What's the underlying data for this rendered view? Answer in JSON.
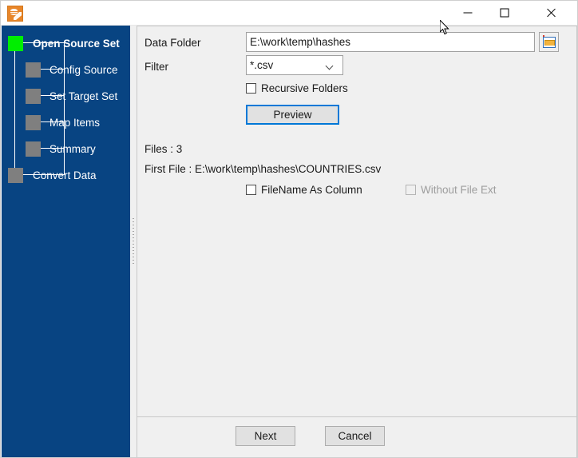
{
  "window": {
    "app_icon": "database-edit-icon",
    "minimize_label": "minimize-icon",
    "maximize_label": "maximize-icon",
    "close_label": "close-icon"
  },
  "sidebar": {
    "steps": [
      {
        "label": "Open Source Set",
        "state": "active"
      },
      {
        "label": "Config Source",
        "state": "pending"
      },
      {
        "label": "Set Target Set",
        "state": "pending"
      },
      {
        "label": "Map Items",
        "state": "pending"
      },
      {
        "label": "Summary",
        "state": "pending"
      },
      {
        "label": "Convert Data",
        "state": "pending"
      }
    ],
    "active_color": "#00ee00",
    "pending_color": "#7f7f7f",
    "background_color": "#084482"
  },
  "form": {
    "data_folder_label": "Data Folder",
    "data_folder_value": "E:\\work\\temp\\hashes",
    "browse_icon": "folder-icon",
    "filter_label": "Filter",
    "filter_value": "*.csv",
    "filter_options": [
      "*.csv"
    ],
    "recursive_label": "Recursive Folders",
    "recursive_checked": false,
    "preview_label": "Preview"
  },
  "results": {
    "files_text": "Files : 3",
    "first_file_text": "First File : E:\\work\\temp\\hashes\\COUNTRIES.csv",
    "filename_as_column_label": "FileName As Column",
    "filename_as_column_checked": false,
    "without_file_ext_label": "Without File Ext",
    "without_file_ext_checked": false,
    "without_file_ext_enabled": false
  },
  "footer": {
    "next_label": "Next",
    "cancel_label": "Cancel"
  }
}
